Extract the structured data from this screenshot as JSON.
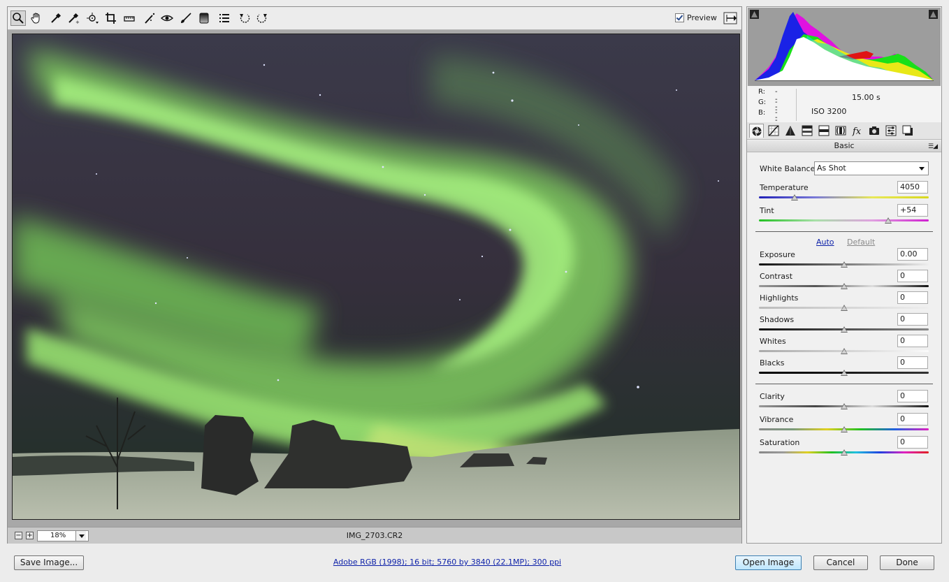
{
  "toolbar": {
    "tools": [
      {
        "name": "zoom-tool",
        "active": true
      },
      {
        "name": "hand-tool"
      },
      {
        "name": "white-balance-tool"
      },
      {
        "name": "color-sampler-tool"
      },
      {
        "name": "targeted-adjustment-tool"
      },
      {
        "name": "crop-tool"
      },
      {
        "name": "straighten-tool"
      },
      {
        "name": "spot-removal-tool"
      },
      {
        "name": "red-eye-removal-tool"
      },
      {
        "name": "adjustment-brush-tool"
      },
      {
        "name": "graduated-filter-tool"
      },
      {
        "name": "preferences-tool"
      },
      {
        "name": "rotate-ccw-tool"
      },
      {
        "name": "rotate-cw-tool"
      }
    ],
    "preview_label": "Preview",
    "preview_checked": true
  },
  "statusbar": {
    "zoom_value": "18%",
    "filename": "IMG_2703.CR2"
  },
  "readout": {
    "r_label": "R:",
    "r_value": "---",
    "g_label": "G:",
    "g_value": "---",
    "b_label": "B:",
    "b_value": "---",
    "shutter": "15.00 s",
    "iso": "ISO 3200"
  },
  "panel": {
    "tabs": [
      "basic",
      "tone-curve",
      "detail",
      "hsl",
      "split-toning",
      "lens-corrections",
      "effects",
      "camera-calibration",
      "presets",
      "snapshots"
    ],
    "section_title": "Basic",
    "section_menu": "☰"
  },
  "basic": {
    "white_balance_label": "White Balance:",
    "white_balance_value": "As Shot",
    "auto_label": "Auto",
    "default_label": "Default",
    "sliders": {
      "temperature": {
        "label": "Temperature",
        "value": "4050",
        "position": 0.21
      },
      "tint": {
        "label": "Tint",
        "value": "+54",
        "position": 0.76
      },
      "exposure": {
        "label": "Exposure",
        "value": "0.00",
        "position": 0.5
      },
      "contrast": {
        "label": "Contrast",
        "value": "0",
        "position": 0.5
      },
      "highlights": {
        "label": "Highlights",
        "value": "0",
        "position": 0.5
      },
      "shadows": {
        "label": "Shadows",
        "value": "0",
        "position": 0.5
      },
      "whites": {
        "label": "Whites",
        "value": "0",
        "position": 0.5
      },
      "blacks": {
        "label": "Blacks",
        "value": "0",
        "position": 0.5
      },
      "clarity": {
        "label": "Clarity",
        "value": "0",
        "position": 0.5
      },
      "vibrance": {
        "label": "Vibrance",
        "value": "0",
        "position": 0.5
      },
      "saturation": {
        "label": "Saturation",
        "value": "0",
        "position": 0.5
      }
    }
  },
  "footer": {
    "save_label": "Save Image...",
    "workflow_link": "Adobe RGB (1998); 16 bit; 5760 by 3840 (22.1MP); 300 ppi",
    "open_label": "Open Image",
    "cancel_label": "Cancel",
    "done_label": "Done"
  },
  "colors": {
    "aurora": "#8fdc6a",
    "sky": "#2b2a3c",
    "snow": "#a9b09a",
    "link": "#0b1fa8"
  }
}
